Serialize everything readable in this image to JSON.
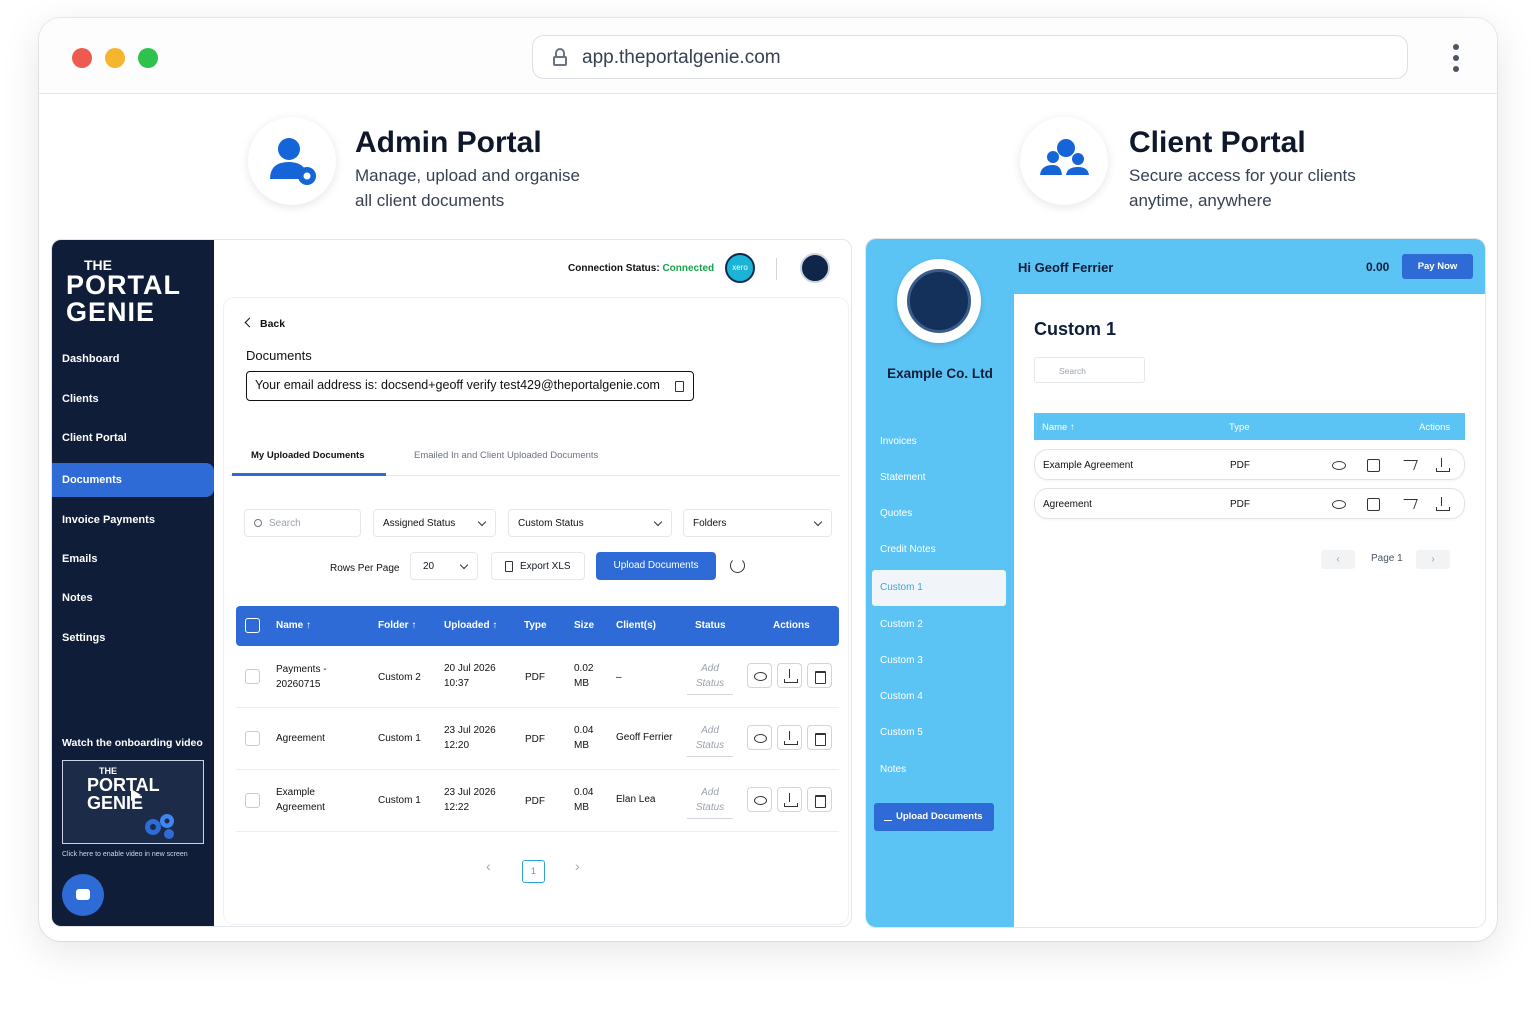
{
  "browser": {
    "url": "app.theportalgenie.com"
  },
  "admin_header": {
    "title": "Admin Portal",
    "subtitle_line1": "Manage, upload and organise",
    "subtitle_line2": "all client documents"
  },
  "client_header": {
    "title": "Client Portal",
    "subtitle_line1": "Secure access for your clients",
    "subtitle_line2": "anytime, anywhere"
  },
  "admin": {
    "logo": {
      "line1": "THE",
      "line2": "PORTAL",
      "line3": "GENIE"
    },
    "nav": [
      "Dashboard",
      "Clients",
      "Client Portal",
      "Documents",
      "Invoice Payments",
      "Emails",
      "Notes",
      "Settings"
    ],
    "active_nav": "Documents",
    "watch_label": "Watch the onboarding video",
    "video_text_1": "THE",
    "video_text_2": "PORTAL",
    "video_text_3": "GENIE",
    "video_note": "Click here to enable video in new screen",
    "connection_label": "Connection Status:",
    "connection_value": "Connected",
    "xero_label": "xero",
    "back_label": "Back",
    "documents_title": "Documents",
    "email_notice": "Your email address is: docsend+geoff verify test429@theportalgenie.com",
    "tabs": [
      "My Uploaded Documents",
      "Emailed In and Client Uploaded Documents"
    ],
    "filters": {
      "search_placeholder": "Search",
      "assigned": "Assigned Status",
      "custom": "Custom Status",
      "folders": "Folders"
    },
    "rows_per_page_label": "Rows Per Page",
    "rows_per_page_value": "20",
    "export_label": "Export XLS",
    "upload_label": "Upload Documents",
    "columns": [
      "Name ↑",
      "Folder ↑",
      "Uploaded ↑",
      "Type",
      "Size",
      "Client(s)",
      "Status",
      "Actions"
    ],
    "rows": [
      {
        "name_1": "Payments -",
        "name_2": "20260715",
        "folder": "Custom 2",
        "date": "20 Jul 2026",
        "time": "10:37",
        "type": "PDF",
        "size_1": "0.02",
        "size_2": "MB",
        "client": "–",
        "status_1": "Add",
        "status_2": "Status"
      },
      {
        "name_1": "Agreement",
        "name_2": "",
        "folder": "Custom 1",
        "date": "23 Jul 2026",
        "time": "12:20",
        "type": "PDF",
        "size_1": "0.04",
        "size_2": "MB",
        "client": "Geoff Ferrier",
        "status_1": "Add",
        "status_2": "Status"
      },
      {
        "name_1": "Example",
        "name_2": "Agreement",
        "folder": "Custom 1",
        "date": "23 Jul 2026",
        "time": "12:22",
        "type": "PDF",
        "size_1": "0.04",
        "size_2": "MB",
        "client": "Elan Lea",
        "status_1": "Add",
        "status_2": "Status"
      }
    ],
    "pager": {
      "prev": "‹",
      "current": "1",
      "next": "›"
    }
  },
  "client": {
    "greeting": "Hi Geoff Ferrier",
    "balance": "0.00",
    "pay_label": "Pay Now",
    "company": "Example Co. Ltd",
    "nav": [
      "Invoices",
      "Statement",
      "Quotes",
      "Credit Notes",
      "Custom 1",
      "Custom 2",
      "Custom 3",
      "Custom 4",
      "Custom 5",
      "Notes"
    ],
    "active_nav": "Custom 1",
    "upload_label": "Upload Documents",
    "page_title": "Custom 1",
    "search_placeholder": "Search",
    "columns": [
      "Name ↑",
      "Type",
      "Actions"
    ],
    "rows": [
      {
        "name": "Example Agreement",
        "type": "PDF"
      },
      {
        "name": "Agreement",
        "type": "PDF"
      }
    ],
    "pager": {
      "prev": "‹",
      "label": "Page 1",
      "next": "›"
    }
  },
  "colors": {
    "primary": "#2e6bd6",
    "sidebar_dark": "#0f1d38",
    "client_accent": "#5cc4f5",
    "connected": "#17a34a"
  }
}
